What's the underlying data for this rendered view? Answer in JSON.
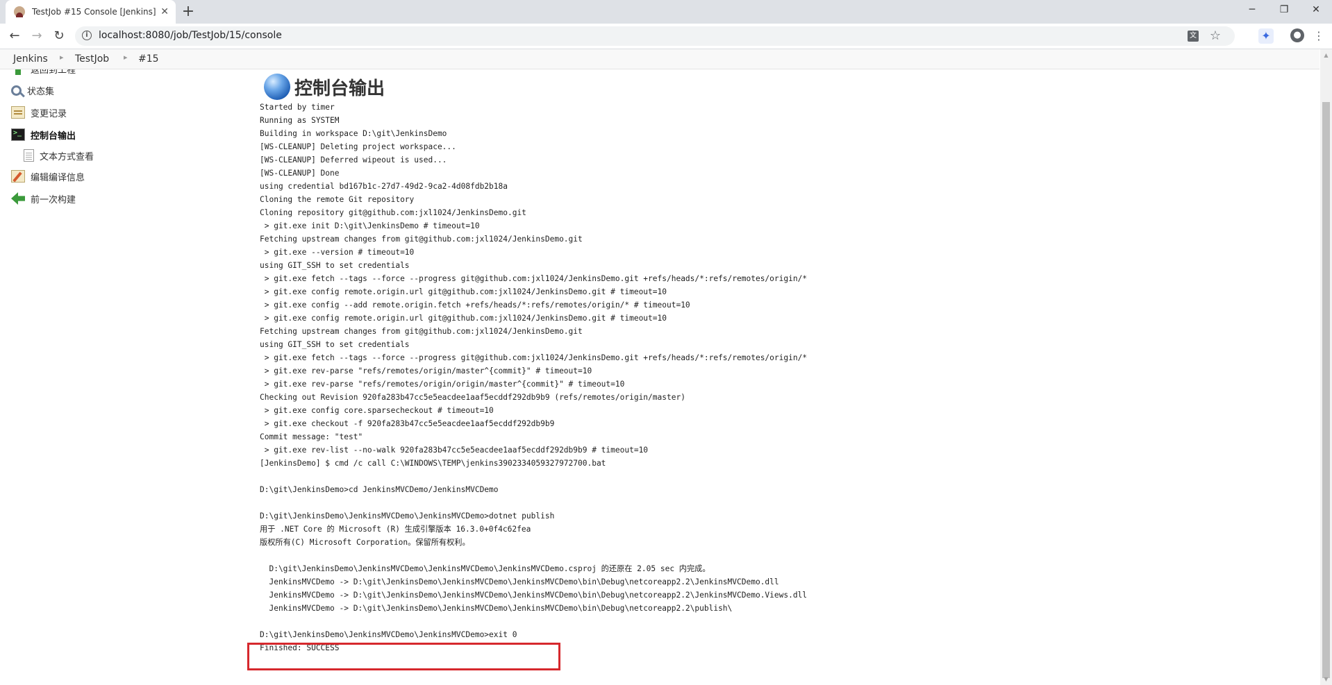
{
  "browser": {
    "tab_title": "TestJob #15 Console [Jenkins]",
    "tab_close": "✕",
    "new_tab": "+",
    "url": "localhost:8080/job/TestJob/15/console",
    "window_controls": {
      "minimize": "─",
      "restore": "❐",
      "close": "✕"
    }
  },
  "breadcrumb": [
    "Jenkins",
    "TestJob",
    "#15"
  ],
  "sidebar": {
    "items": [
      {
        "label": "返回到工程",
        "icon": "up-arrow-icon"
      },
      {
        "label": "状态集",
        "icon": "search-icon"
      },
      {
        "label": "变更记录",
        "icon": "notepad-icon"
      },
      {
        "label": "控制台输出",
        "icon": "terminal-icon",
        "active": true
      },
      {
        "label": "文本方式查看",
        "icon": "document-icon"
      },
      {
        "label": "编辑编译信息",
        "icon": "edit-icon"
      },
      {
        "label": "前一次构建",
        "icon": "back-arrow-icon"
      }
    ]
  },
  "main": {
    "heading": "控制台输出",
    "console_lines": [
      "Started by timer",
      "Running as SYSTEM",
      "Building in workspace D:\\git\\JenkinsDemo",
      "[WS-CLEANUP] Deleting project workspace...",
      "[WS-CLEANUP] Deferred wipeout is used...",
      "[WS-CLEANUP] Done",
      "using credential bd167b1c-27d7-49d2-9ca2-4d08fdb2b18a",
      "Cloning the remote Git repository",
      "Cloning repository git@github.com:jxl1024/JenkinsDemo.git",
      " > git.exe init D:\\git\\JenkinsDemo # timeout=10",
      "Fetching upstream changes from git@github.com:jxl1024/JenkinsDemo.git",
      " > git.exe --version # timeout=10",
      "using GIT_SSH to set credentials",
      " > git.exe fetch --tags --force --progress git@github.com:jxl1024/JenkinsDemo.git +refs/heads/*:refs/remotes/origin/*",
      " > git.exe config remote.origin.url git@github.com:jxl1024/JenkinsDemo.git # timeout=10",
      " > git.exe config --add remote.origin.fetch +refs/heads/*:refs/remotes/origin/* # timeout=10",
      " > git.exe config remote.origin.url git@github.com:jxl1024/JenkinsDemo.git # timeout=10",
      "Fetching upstream changes from git@github.com:jxl1024/JenkinsDemo.git",
      "using GIT_SSH to set credentials",
      " > git.exe fetch --tags --force --progress git@github.com:jxl1024/JenkinsDemo.git +refs/heads/*:refs/remotes/origin/*",
      " > git.exe rev-parse \"refs/remotes/origin/master^{commit}\" # timeout=10",
      " > git.exe rev-parse \"refs/remotes/origin/origin/master^{commit}\" # timeout=10",
      "Checking out Revision 920fa283b47cc5e5eacdee1aaf5ecddf292db9b9 (refs/remotes/origin/master)",
      " > git.exe config core.sparsecheckout # timeout=10",
      " > git.exe checkout -f 920fa283b47cc5e5eacdee1aaf5ecddf292db9b9",
      "Commit message: \"test\"",
      " > git.exe rev-list --no-walk 920fa283b47cc5e5eacdee1aaf5ecddf292db9b9 # timeout=10",
      "[JenkinsDemo] $ cmd /c call C:\\WINDOWS\\TEMP\\jenkins3902334059327972700.bat",
      "",
      "D:\\git\\JenkinsDemo>cd JenkinsMVCDemo/JenkinsMVCDemo",
      "",
      "D:\\git\\JenkinsDemo\\JenkinsMVCDemo\\JenkinsMVCDemo>dotnet publish",
      "用于 .NET Core 的 Microsoft (R) 生成引擎版本 16.3.0+0f4c62fea",
      "版权所有(C) Microsoft Corporation。保留所有权利。",
      "",
      "  D:\\git\\JenkinsDemo\\JenkinsMVCDemo\\JenkinsMVCDemo\\JenkinsMVCDemo.csproj 的还原在 2.05 sec 内完成。",
      "  JenkinsMVCDemo -> D:\\git\\JenkinsDemo\\JenkinsMVCDemo\\JenkinsMVCDemo\\bin\\Debug\\netcoreapp2.2\\JenkinsMVCDemo.dll",
      "  JenkinsMVCDemo -> D:\\git\\JenkinsDemo\\JenkinsMVCDemo\\JenkinsMVCDemo\\bin\\Debug\\netcoreapp2.2\\JenkinsMVCDemo.Views.dll",
      "  JenkinsMVCDemo -> D:\\git\\JenkinsDemo\\JenkinsMVCDemo\\JenkinsMVCDemo\\bin\\Debug\\netcoreapp2.2\\publish\\",
      "",
      "D:\\git\\JenkinsDemo\\JenkinsMVCDemo\\JenkinsMVCDemo>exit 0",
      "Finished: SUCCESS"
    ]
  },
  "colors": {
    "highlight_border": "#d6282d",
    "tabstrip_bg": "#dee1e6",
    "crumbbar_bg": "#f8f8f8"
  }
}
